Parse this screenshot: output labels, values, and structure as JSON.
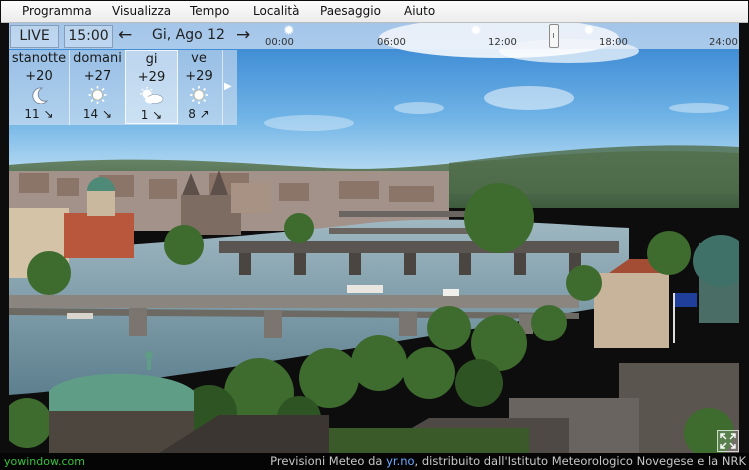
{
  "menu": [
    "Programma",
    "Visualizza",
    "Tempo",
    "Località",
    "Paesaggio",
    "Aiuto"
  ],
  "toolbar": {
    "live_label": "LIVE",
    "time_label": "15:00",
    "date_label": "Gi, Ago 12",
    "prev_icon": "arrow-left-icon",
    "next_icon": "arrow-right-icon"
  },
  "timeline": {
    "ticks": [
      "00:00",
      "06:00",
      "12:00",
      "18:00",
      "24:00"
    ]
  },
  "forecast": [
    {
      "name": "stanotte",
      "temp": "+20",
      "icon": "moon-icon",
      "wind": "11 ↘"
    },
    {
      "name": "domani",
      "temp": "+27",
      "icon": "sun-icon",
      "wind": "14 ↘"
    },
    {
      "name": "gi",
      "temp": "+29",
      "icon": "sun-cloud-icon",
      "wind": "1 ↘"
    },
    {
      "name": "ve",
      "temp": "+29",
      "icon": "sun-icon",
      "wind": "8 ↗"
    }
  ],
  "footer": {
    "brand": "yowindow.com",
    "credit_prefix": "Previsioni Meteo da ",
    "credit_link": "yr.no",
    "credit_suffix": ", distribuito dall'Istituto Meteorologico Novegese e la NRK"
  },
  "colors": {
    "brand_green": "#36c33a",
    "link_blue": "#6fa9ff",
    "sky_top": "#2f7fcf",
    "sky_bottom": "#bfe0f3",
    "river": "#6e93a3"
  }
}
